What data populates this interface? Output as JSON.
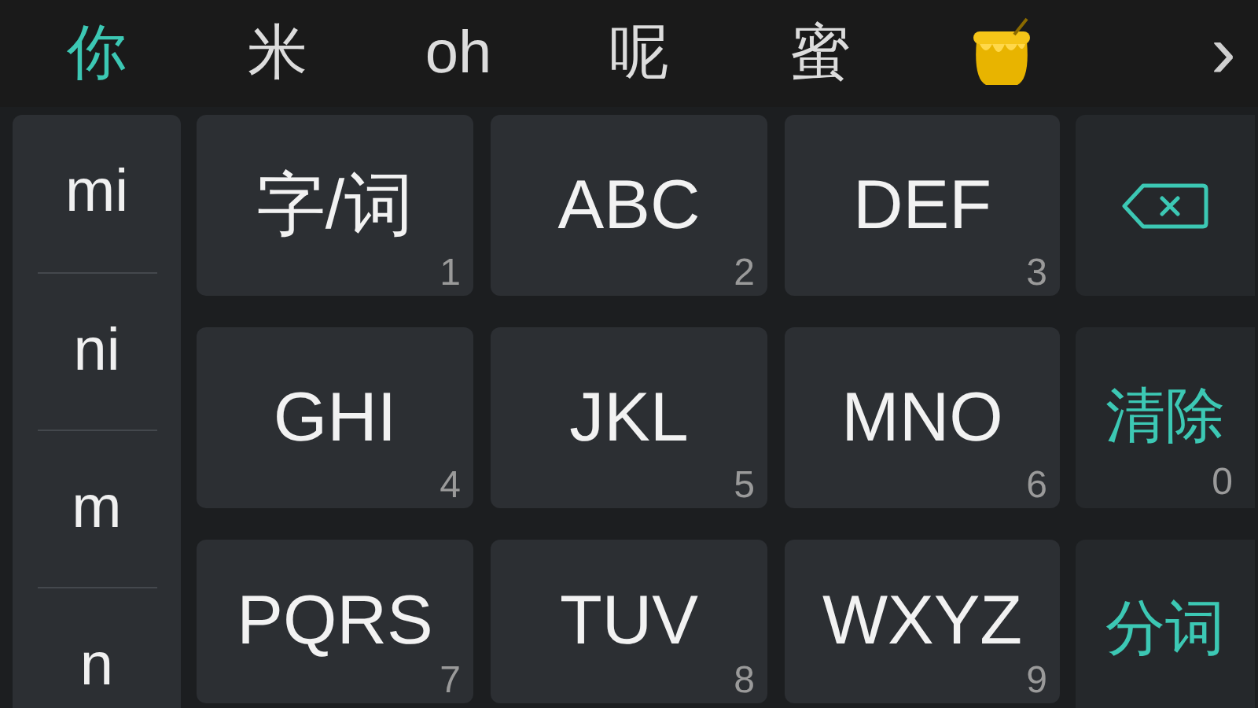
{
  "candidates": [
    {
      "kind": "text",
      "label": "你",
      "selected": true
    },
    {
      "kind": "text",
      "label": "米",
      "selected": false
    },
    {
      "kind": "text",
      "label": "oh",
      "selected": false
    },
    {
      "kind": "text",
      "label": "呢",
      "selected": false
    },
    {
      "kind": "text",
      "label": "蜜",
      "selected": false
    },
    {
      "kind": "icon",
      "selected": false
    }
  ],
  "more": "›",
  "pinyin": [
    "mi",
    "ni",
    "m",
    "n"
  ],
  "keys": [
    {
      "label": "字/词",
      "number": "1"
    },
    {
      "label": "ABC",
      "number": "2"
    },
    {
      "label": "DEF",
      "number": "3"
    },
    {
      "label": "GHI",
      "number": "4"
    },
    {
      "label": "JKL",
      "number": "5"
    },
    {
      "label": "MNO",
      "number": "6"
    },
    {
      "label": "PQRS",
      "number": "7"
    },
    {
      "label": "TUV",
      "number": "8"
    },
    {
      "label": "WXYZ",
      "number": "9"
    }
  ],
  "side_keys": [
    {
      "kind": "backspace"
    },
    {
      "kind": "text",
      "label": "清除",
      "number": "0"
    },
    {
      "kind": "text",
      "label": "分词"
    }
  ]
}
